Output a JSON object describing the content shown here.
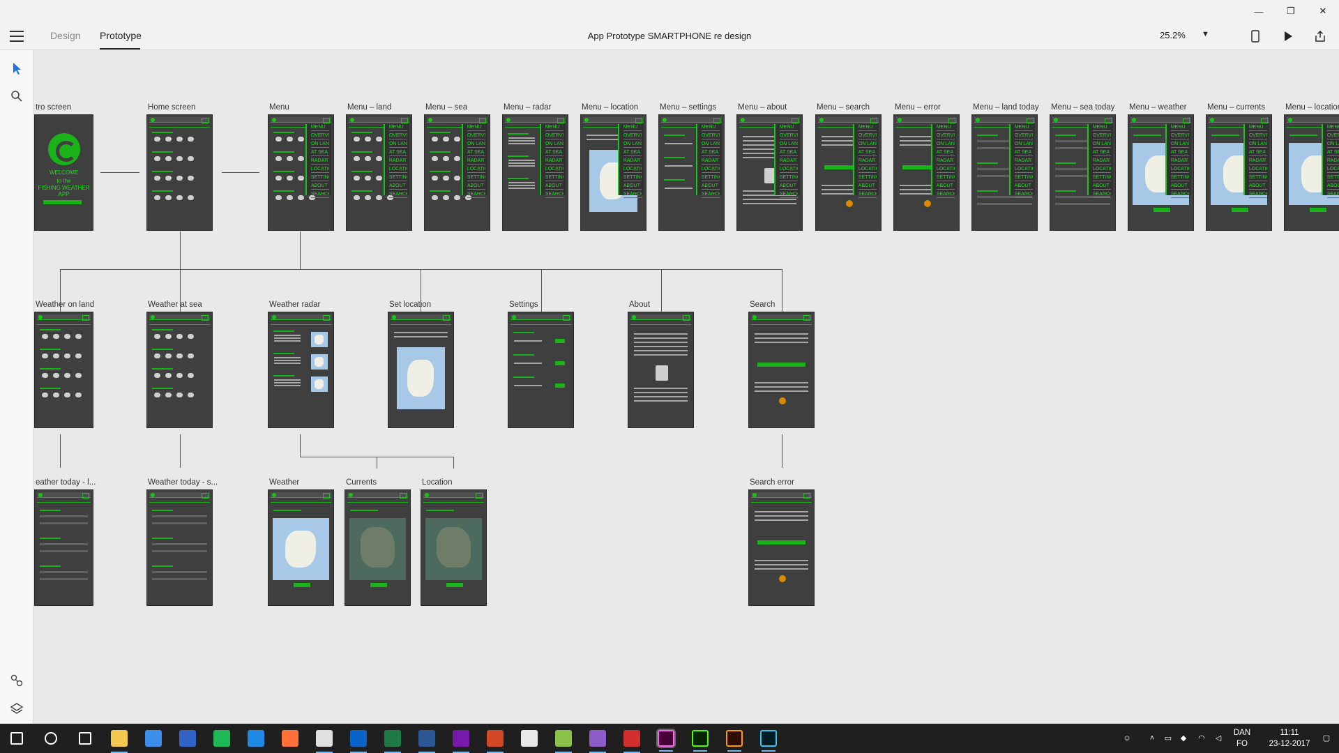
{
  "window": {
    "minimize_glyph": "—",
    "restore_glyph": "❐",
    "close_glyph": "✕"
  },
  "toolbar": {
    "design_tab": "Design",
    "prototype_tab": "Prototype",
    "document_title": "App Prototype SMARTPHONE re design",
    "zoom": "25.2%"
  },
  "left_tools": [
    "select-arrow-icon",
    "search-icon",
    "connect-icon",
    "layers-icon"
  ],
  "artboards": {
    "row1": [
      "tro screen",
      "Home screen",
      "Menu",
      "Menu – land",
      "Menu – sea",
      "Menu – radar",
      "Menu – location",
      "Menu – settings",
      "Menu – about",
      "Menu – search",
      "Menu – error",
      "Menu – land today",
      "Menu – sea today",
      "Menu – weather",
      "Menu – currents",
      "Menu – location"
    ],
    "row2": [
      "Weather on land",
      "Weather at sea",
      "Weather radar",
      "Set location",
      "Settings",
      "About",
      "Search"
    ],
    "row3": [
      "eather today - l...",
      "Weather today - s...",
      "Weather",
      "Currents",
      "Location",
      "Search error"
    ]
  },
  "intro": {
    "welcome": "WELCOME",
    "to_the": "to the",
    "app_name": "FISHING WEATHER APP"
  },
  "menu_items": [
    "OVERVIEW",
    "ON LAND",
    "AT SEA",
    "RADAR",
    "LOCATION",
    "SETTINGS",
    "ABOUT",
    "SEARCH"
  ],
  "menu_header": "MENU",
  "taskbar": {
    "apps": [
      "windows-start-icon",
      "search-icon",
      "task-view-icon",
      "file-explorer-icon",
      "store-icon",
      "password-manager-icon",
      "spotify-icon",
      "edge-icon",
      "firefox-icon",
      "chrome-icon",
      "outlook-icon",
      "excel-icon",
      "word-icon",
      "onenote-icon",
      "powerpoint-icon",
      "calculator-icon",
      "notepad-icon",
      "podcast-icon",
      "vpn-icon",
      "adobe-xd-icon",
      "dreamweaver-icon",
      "illustrator-icon",
      "photoshop-icon"
    ],
    "lang_top": "DAN",
    "lang_bottom": "FO",
    "time": "11:11",
    "date": "23-12-2017"
  },
  "colors": {
    "accent_green": "#19b319",
    "artboard_bg": "#3f3f3f",
    "canvas_bg": "#e9e9e9"
  }
}
